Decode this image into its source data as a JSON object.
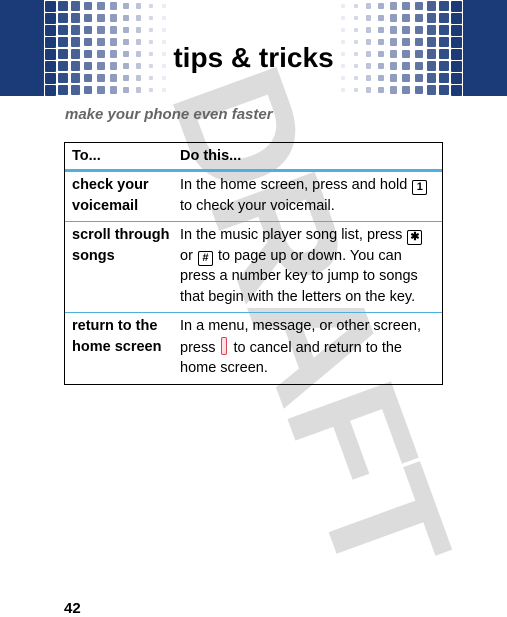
{
  "header": {
    "title": "tips & tricks",
    "brand_color": "#1b3a78"
  },
  "subtitle": "make your phone even faster",
  "watermark": "DRAFT",
  "table": {
    "columns": [
      "To...",
      "Do this..."
    ],
    "rows": [
      {
        "to": "check your voicemail",
        "do_parts": [
          {
            "type": "text",
            "value": "In the home screen, press and hold "
          },
          {
            "type": "key",
            "icon": "key-1-icon",
            "value": "1"
          },
          {
            "type": "text",
            "value": " to check your voicemail."
          }
        ]
      },
      {
        "to": "scroll through songs",
        "do_parts": [
          {
            "type": "text",
            "value": "In the music player song list, press "
          },
          {
            "type": "key",
            "icon": "key-star-icon",
            "value": "✱"
          },
          {
            "type": "text",
            "value": " or "
          },
          {
            "type": "key",
            "icon": "key-pound-icon",
            "value": "#"
          },
          {
            "type": "text",
            "value": " to page up or down. You can press a number key to jump to songs that begin with the letters on the key."
          }
        ]
      },
      {
        "to": "return to the home screen",
        "do_parts": [
          {
            "type": "text",
            "value": "In a menu, message, or other screen, press "
          },
          {
            "type": "endkey",
            "icon": "end-key-icon",
            "value": ""
          },
          {
            "type": "text",
            "value": " to cancel and return to the home screen."
          }
        ]
      }
    ],
    "accent_color": "#4fb0e0"
  },
  "page_number": "42"
}
